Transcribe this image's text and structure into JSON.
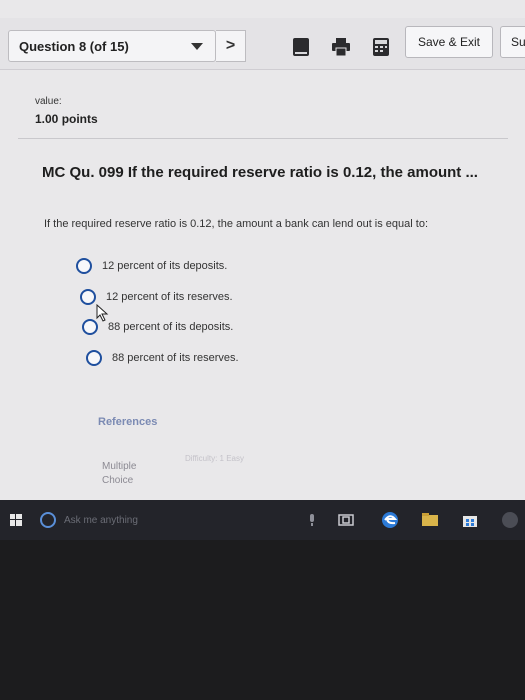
{
  "toolbar": {
    "question_select": "Question 8 (of 15)",
    "next_label": ">",
    "save_exit_label": "Save & Exit",
    "submit_label": "Su"
  },
  "question": {
    "value_label": "value:",
    "value_points": "1.00 points",
    "title": "MC Qu. 099 If the required reserve ratio is 0.12, the amount ...",
    "text": "If the required reserve ratio is 0.12, the amount a bank can lend out is equal to:",
    "options": [
      "12 percent of its deposits.",
      "12 percent of its reserves.",
      "88 percent of its deposits.",
      "88 percent of its reserves."
    ],
    "references_label": "References",
    "type_label_line1": "Multiple",
    "type_label_line2": "Choice",
    "difficulty_tag": "Difficulty: 1 Easy"
  },
  "taskbar": {
    "search_placeholder": "Ask me anything"
  },
  "colors": {
    "radio_border": "#1f4f9e",
    "references_text": "#7b8ab3",
    "taskbar_bg": "#23242a"
  }
}
